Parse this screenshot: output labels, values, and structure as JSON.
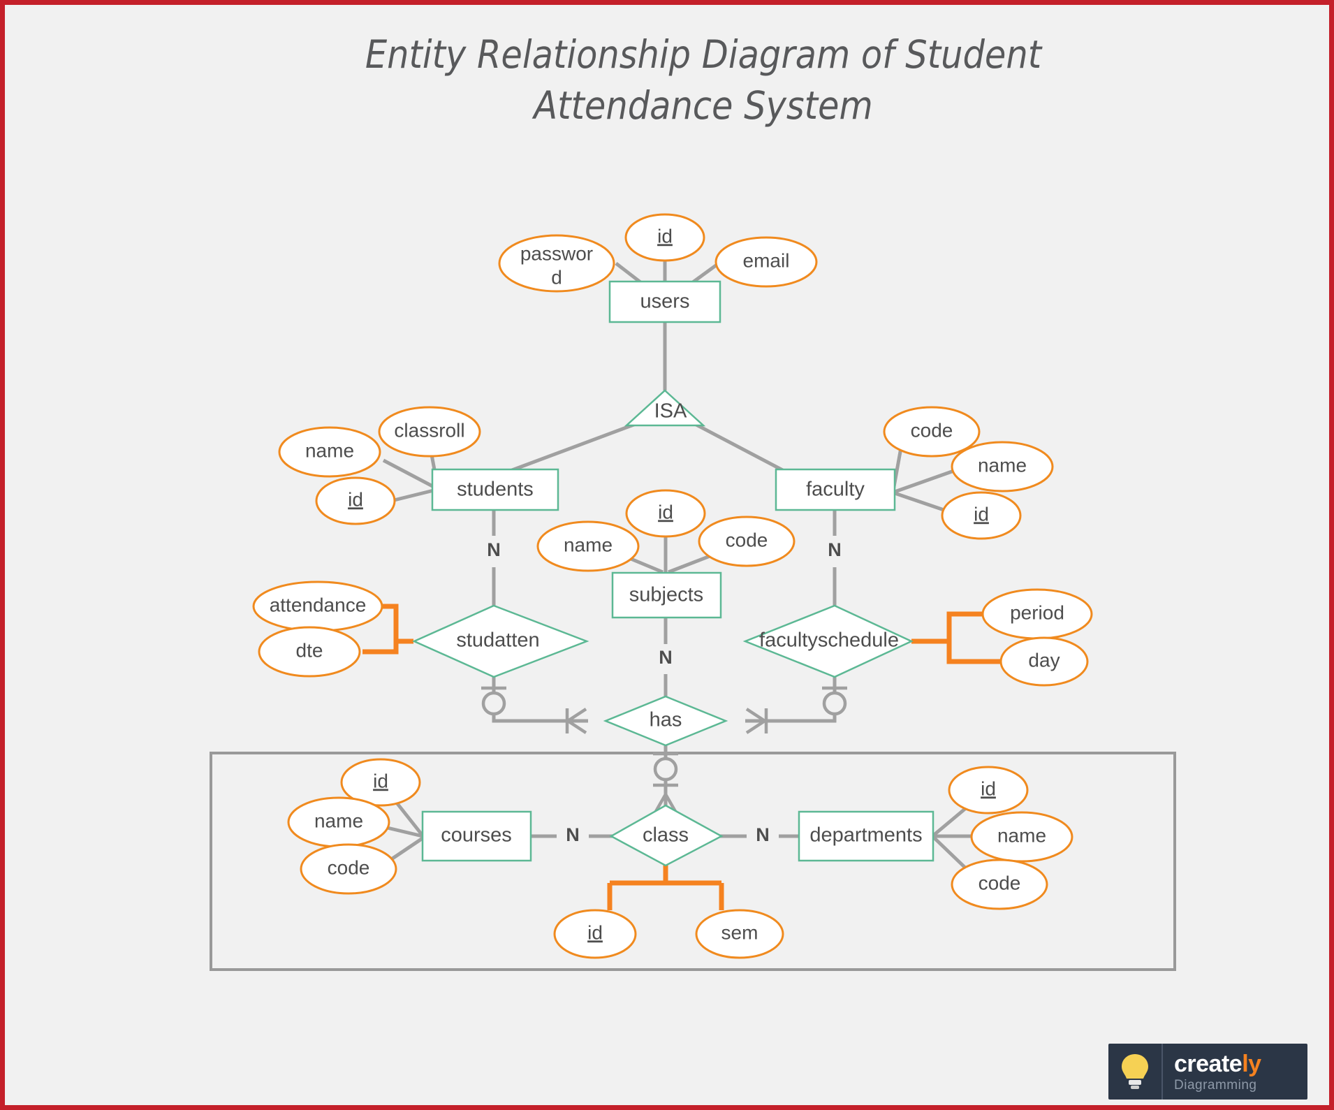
{
  "page": {
    "border_color": "#c4202a",
    "canvas_color": "#f1f1f1"
  },
  "title": {
    "line1": "Entity Relationship Diagram of Student",
    "line2": "Attendance System"
  },
  "palette": {
    "entity_stroke": "#5cb894",
    "attribute_stroke": "#f08a1e",
    "connector_gray": "#a0a0a0",
    "connector_orange": "#f58220",
    "text": "#4d4d4d",
    "group_stroke": "#999999"
  },
  "entities": [
    {
      "id": "users",
      "label": "users"
    },
    {
      "id": "students",
      "label": "students"
    },
    {
      "id": "faculty",
      "label": "faculty"
    },
    {
      "id": "subjects",
      "label": "subjects"
    },
    {
      "id": "courses",
      "label": "courses"
    },
    {
      "id": "departments",
      "label": "departments"
    }
  ],
  "relationships": [
    {
      "id": "studatten",
      "label": "studatten"
    },
    {
      "id": "facultyschedule",
      "label": "facultyschedule"
    },
    {
      "id": "has",
      "label": "has"
    },
    {
      "id": "class",
      "label": "class"
    }
  ],
  "generalization": {
    "id": "isa",
    "label": "ISA"
  },
  "attributes": {
    "users": [
      {
        "label": "password",
        "line1": "passwor",
        "line2": "d",
        "key": false
      },
      {
        "label": "id",
        "key": true
      },
      {
        "label": "email",
        "key": false
      }
    ],
    "students": [
      {
        "label": "name",
        "key": false
      },
      {
        "label": "classroll",
        "key": false
      },
      {
        "label": "id",
        "key": true
      }
    ],
    "faculty": [
      {
        "label": "code",
        "key": false
      },
      {
        "label": "name",
        "key": false
      },
      {
        "label": "id",
        "key": true
      }
    ],
    "subjects": [
      {
        "label": "id",
        "key": true
      },
      {
        "label": "name",
        "key": false
      },
      {
        "label": "code",
        "key": false
      }
    ],
    "studatten": [
      {
        "label": "attendance",
        "key": false
      },
      {
        "label": "dte",
        "key": false
      }
    ],
    "facultyschedule": [
      {
        "label": "period",
        "key": false
      },
      {
        "label": "day",
        "key": false
      }
    ],
    "courses": [
      {
        "label": "id",
        "key": true
      },
      {
        "label": "name",
        "key": false
      },
      {
        "label": "code",
        "key": false
      }
    ],
    "departments": [
      {
        "label": "id",
        "key": true
      },
      {
        "label": "name",
        "key": false
      },
      {
        "label": "code",
        "key": false
      }
    ],
    "class": [
      {
        "label": "id",
        "key": true
      },
      {
        "label": "sem",
        "key": false
      }
    ]
  },
  "cardinalities": [
    {
      "id": "students-studatten",
      "label": "N"
    },
    {
      "id": "faculty-facultyschedule",
      "label": "N"
    },
    {
      "id": "subjects-has",
      "label": "N"
    },
    {
      "id": "courses-class",
      "label": "N"
    },
    {
      "id": "class-departments",
      "label": "N"
    }
  ],
  "logo": {
    "icon": "lightbulb-icon",
    "word_main": "create",
    "word_accent": "ly",
    "subtitle": "Diagramming"
  }
}
